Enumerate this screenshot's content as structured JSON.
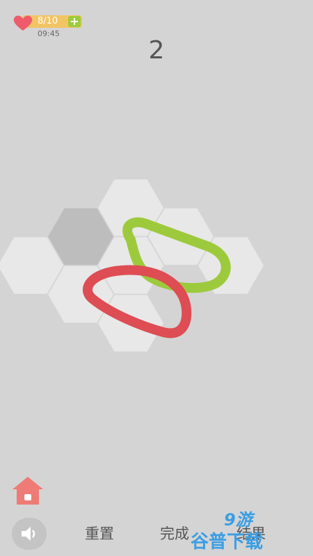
{
  "status": {
    "lives": "8/10",
    "add_lives_label": "+",
    "time": "09:45",
    "icons": [
      "heart-icon",
      "plus-icon"
    ]
  },
  "level": {
    "number": "2"
  },
  "puzzle": {
    "tiles": [
      {
        "q": 0,
        "r": -1
      },
      {
        "q": 1,
        "r": -1
      },
      {
        "q": 2,
        "r": -1
      },
      {
        "q": -1,
        "r": 0,
        "filled": true
      },
      {
        "q": 0,
        "r": 0
      },
      {
        "q": -2,
        "r": 1
      },
      {
        "q": -1,
        "r": 1
      },
      {
        "q": 0,
        "r": 1
      }
    ],
    "loops": [
      {
        "color": "#9dca3c"
      },
      {
        "color": "#dd4d53"
      }
    ]
  },
  "controls": {
    "home_icon": "house-icon",
    "sound_icon": "speaker-icon",
    "reset_label": "重置",
    "finish_label": "完成",
    "third_label": "结果"
  },
  "watermark": {
    "text": "9游 谷普下载",
    "brand": "9游"
  },
  "colors": {
    "background": "#d4d4d4",
    "tile": "#e8e8e8",
    "tile_filled": "#bdbdbd",
    "heart": "#ee5b6d",
    "lives_bar": "#f2c464",
    "plus": "#9ccc3a",
    "home": "#ee7b75"
  }
}
